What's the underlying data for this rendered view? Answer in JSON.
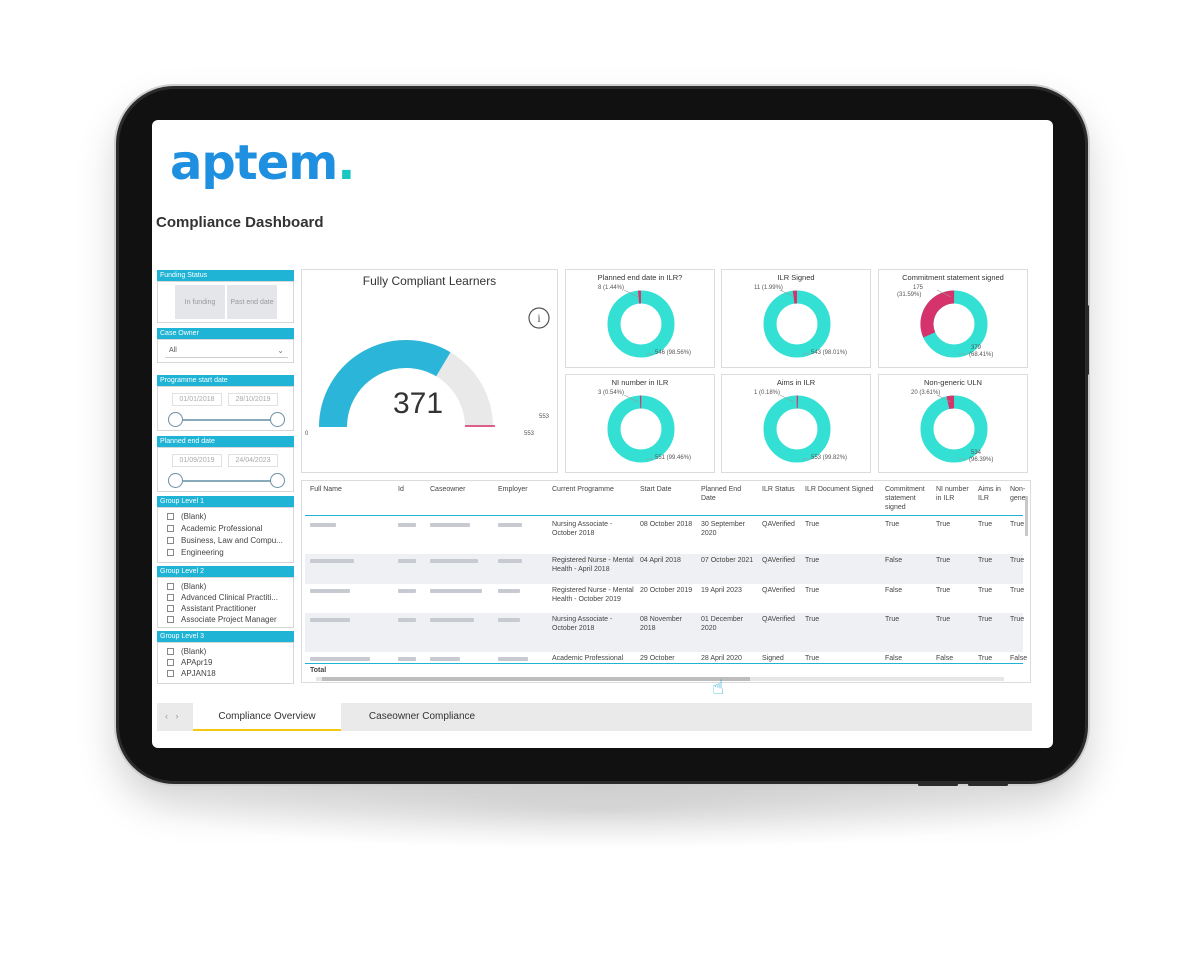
{
  "brand": {
    "logo_main": "aptem",
    "logo_dot": "."
  },
  "page_title": "Compliance Dashboard",
  "slicers": {
    "funding_status": {
      "title": "Funding Status",
      "options": [
        "In funding",
        "Past end date"
      ]
    },
    "case_owner": {
      "title": "Case Owner",
      "selected": "All"
    },
    "programme_start_date": {
      "title": "Programme start date",
      "from": "01/01/2018",
      "to": "28/10/2019"
    },
    "planned_end_date": {
      "title": "Planned end date",
      "from": "01/09/2019",
      "to": "24/04/2023"
    },
    "group_level_1": {
      "title": "Group Level 1",
      "items": [
        "(Blank)",
        "Academic Professional",
        "Business, Law and Compu...",
        "Engineering"
      ]
    },
    "group_level_2": {
      "title": "Group Level 2",
      "items": [
        "(Blank)",
        "Advanced Clinical Practiti...",
        "Assistant Practitioner",
        "Associate Project Manager"
      ]
    },
    "group_level_3": {
      "title": "Group Level 3",
      "items": [
        "(Blank)",
        "APApr19",
        "APJAN18"
      ]
    }
  },
  "gauge": {
    "title": "Fully Compliant Learners",
    "value": 371,
    "value_text": "371",
    "min_text": "0",
    "max": 553,
    "max_text": "553",
    "target_text": "553",
    "info_icon": "info-icon",
    "fill_color": "#2bb5d8",
    "track_color": "#e9e9e9"
  },
  "donuts": [
    {
      "title": "Planned end date in ILR?",
      "minor_label": "8 (1.44%)",
      "major_label": "546 (98.56%)",
      "minor_fraction": 0.0144,
      "minor_color": "#d6336c",
      "major_color": "#34e0d4"
    },
    {
      "title": "ILR Signed",
      "minor_label": "11 (1.99%)",
      "major_label": "543 (98.01%)",
      "minor_fraction": 0.0199,
      "minor_color": "#d6336c",
      "major_color": "#34e0d4"
    },
    {
      "title": "Commitment statement signed",
      "minor_label_top": "175",
      "minor_label_bottom": "(31.59%)",
      "major_label_top": "379",
      "major_label_bottom": "(68.41%)",
      "minor_fraction": 0.3159,
      "minor_color": "#d6336c",
      "major_color": "#34e0d4"
    },
    {
      "title": "NI number in ILR",
      "minor_label": "3 (0.54%)",
      "major_label": "551 (99.46%)",
      "minor_fraction": 0.0054,
      "minor_color": "#d6336c",
      "major_color": "#34e0d4"
    },
    {
      "title": "Aims in ILR",
      "minor_label": "1 (0.18%)",
      "major_label": "553 (99.82%)",
      "minor_fraction": 0.0018,
      "minor_color": "#d6336c",
      "major_color": "#34e0d4"
    },
    {
      "title": "Non-generic ULN",
      "minor_label": "20 (3.61%)",
      "major_label_top": "534",
      "major_label_bottom": "(96.39%)",
      "minor_fraction": 0.0361,
      "minor_color": "#d6336c",
      "major_color": "#34e0d4"
    }
  ],
  "table": {
    "columns": [
      "Full Name",
      "Id",
      "Caseowner",
      "Employer",
      "Current Programme",
      "Start Date",
      "Planned End Date",
      "ILR Status",
      "ILR Document Signed",
      "Commitment statement signed",
      "NI number in ILR",
      "Aims in ILR",
      "Non-generic"
    ],
    "rows": [
      {
        "programme": "Nursing Associate - October 2018",
        "start": "08 October 2018",
        "end": "30 September 2020",
        "ilr_status": "QAVerified",
        "ilr_doc": "True",
        "commitment": "True",
        "ni": "True",
        "aims": "True",
        "uln": "True"
      },
      {
        "programme": "Registered Nurse - Mental Health - April 2018",
        "start": "04 April 2018",
        "end": "07 October 2021",
        "ilr_status": "QAVerified",
        "ilr_doc": "True",
        "commitment": "False",
        "ni": "True",
        "aims": "True",
        "uln": "True"
      },
      {
        "programme": "Registered Nurse - Mental Health - October 2019",
        "start": "20 October 2019",
        "end": "19 April 2023",
        "ilr_status": "QAVerified",
        "ilr_doc": "True",
        "commitment": "False",
        "ni": "True",
        "aims": "True",
        "uln": "True"
      },
      {
        "programme": "Nursing Associate - October 2018",
        "start": "08 November 2018",
        "end": "01 December 2020",
        "ilr_status": "QAVerified",
        "ilr_doc": "True",
        "commitment": "True",
        "ni": "True",
        "aims": "True",
        "uln": "True"
      },
      {
        "programme": "Academic Professional",
        "start": "29 October",
        "end": "28 April 2020",
        "ilr_status": "Signed",
        "ilr_doc": "True",
        "commitment": "False",
        "ni": "False",
        "aims": "True",
        "uln": "False"
      }
    ],
    "total_label": "Total"
  },
  "tabs": {
    "prev": "‹",
    "next": "›",
    "items": [
      "Compliance Overview",
      "Caseowner Compliance"
    ],
    "active_index": 0
  },
  "accent": {
    "slicer_header": "#1fb3d6",
    "tab_underline": "#f2c811"
  }
}
